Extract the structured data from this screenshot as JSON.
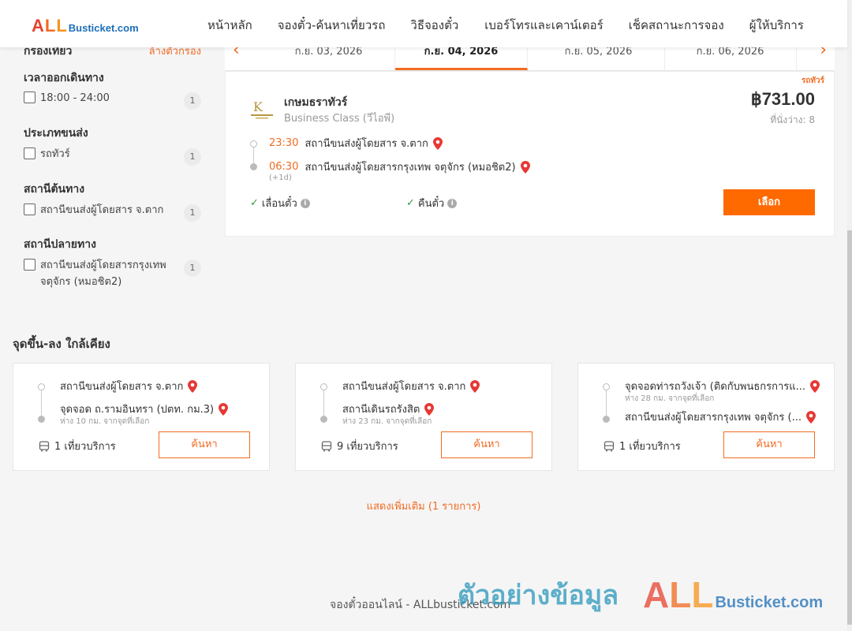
{
  "header": {
    "logo_all": [
      "A",
      "L",
      "L"
    ],
    "logo_rest": "Busticket.com",
    "nav": [
      "หน้าหลัก",
      "จองตั๋ว-ค้นหาเที่ยวรถ",
      "วิธีจองตั๋ว",
      "เบอร์โทรและเคาน์เตอร์",
      "เช็คสถานะการจอง",
      "ผู้ให้บริการ"
    ]
  },
  "filters": {
    "title": "กรองเที่ยว",
    "clear": "ล้างตัวกรอง",
    "groups": [
      {
        "title": "เวลาออกเดินทาง",
        "options": [
          {
            "label": "18:00 - 24:00",
            "count": "1"
          }
        ]
      },
      {
        "title": "ประเภทขนส่ง",
        "options": [
          {
            "label": "รถทัวร์",
            "count": "1"
          }
        ]
      },
      {
        "title": "สถานีต้นทาง",
        "options": [
          {
            "label": "สถานีขนส่งผู้โดยสาร จ.ตาก",
            "count": "1"
          }
        ]
      },
      {
        "title": "สถานีปลายทาง",
        "options": [
          {
            "label": "สถานีขนส่งผู้โดยสารกรุงเทพ จตุจักร (หมอชิต2)",
            "count": "1"
          }
        ]
      }
    ]
  },
  "dates": {
    "tabs": [
      "ก.ย. 03, 2026",
      "ก.ย. 04, 2026",
      "ก.ย. 05, 2026",
      "ก.ย. 06, 2026"
    ],
    "active_index": 1
  },
  "trip": {
    "type_badge": "รถทัวร์",
    "operator": "เกษมธราทัวร์",
    "operator_logo_text": "K",
    "class": "Business Class (วีไอพี)",
    "price": "฿731.00",
    "seats": "ที่นั่งว่าง: 8",
    "depart_time": "23:30",
    "depart_station": "สถานีขนส่งผู้โดยสาร จ.ตาก",
    "arrive_time": "06:30",
    "arrive_station": "สถานีขนส่งผู้โดยสารกรุงเทพ จตุจักร (หมอชิต2)",
    "next_day": "(+1d)",
    "feature_1": "เลื่อนตั๋ว",
    "feature_2": "คืนตั๋ว",
    "select_label": "เลือก"
  },
  "nearby": {
    "title": "จุดขึ้น-ลง ใกล้เคียง",
    "cards": [
      {
        "from": "สถานีขนส่งผู้โดยสาร จ.ตาก",
        "from_dist": "",
        "to": "จุดจอด ถ.รามอินทรา (ปตท. กม.3)",
        "to_dist": "ห่าง 10 กม. จากจุดที่เลือก",
        "trips": "1 เที่ยวบริการ",
        "button": "ค้นหา"
      },
      {
        "from": "สถานีขนส่งผู้โดยสาร จ.ตาก",
        "from_dist": "",
        "to": "สถานีเดินรถรังสิต",
        "to_dist": "ห่าง 23 กม. จากจุดที่เลือก",
        "trips": "9 เที่ยวบริการ",
        "button": "ค้นหา"
      },
      {
        "from": "จุดจอดท่ารถวังเจ้า (ติดกับพนธกรการแ...",
        "from_dist": "ห่าง 28 กม. จากจุดที่เลือก",
        "to": "สถานีขนส่งผู้โดยสารกรุงเทพ จตุจักร (...",
        "to_dist": "",
        "trips": "1 เที่ยวบริการ",
        "button": "ค้นหา"
      }
    ],
    "show_more": "แสดงเพิ่มเติม (1 รายการ)"
  },
  "footer": {
    "text": "จองตั๋วออนไลน์ - ALLbusticket.com",
    "watermark_thai": "ตัวอย่างข้อมูล",
    "watermark_logo_all": [
      "A",
      "L",
      "L"
    ],
    "watermark_logo_rest": "Busticket.com"
  },
  "colors": {
    "accent": "#ff6a00",
    "brand_red": "#e8432f",
    "brand_blue": "#1d6fb8",
    "pin_red": "#e53935",
    "check_green": "#2e9a3f"
  }
}
